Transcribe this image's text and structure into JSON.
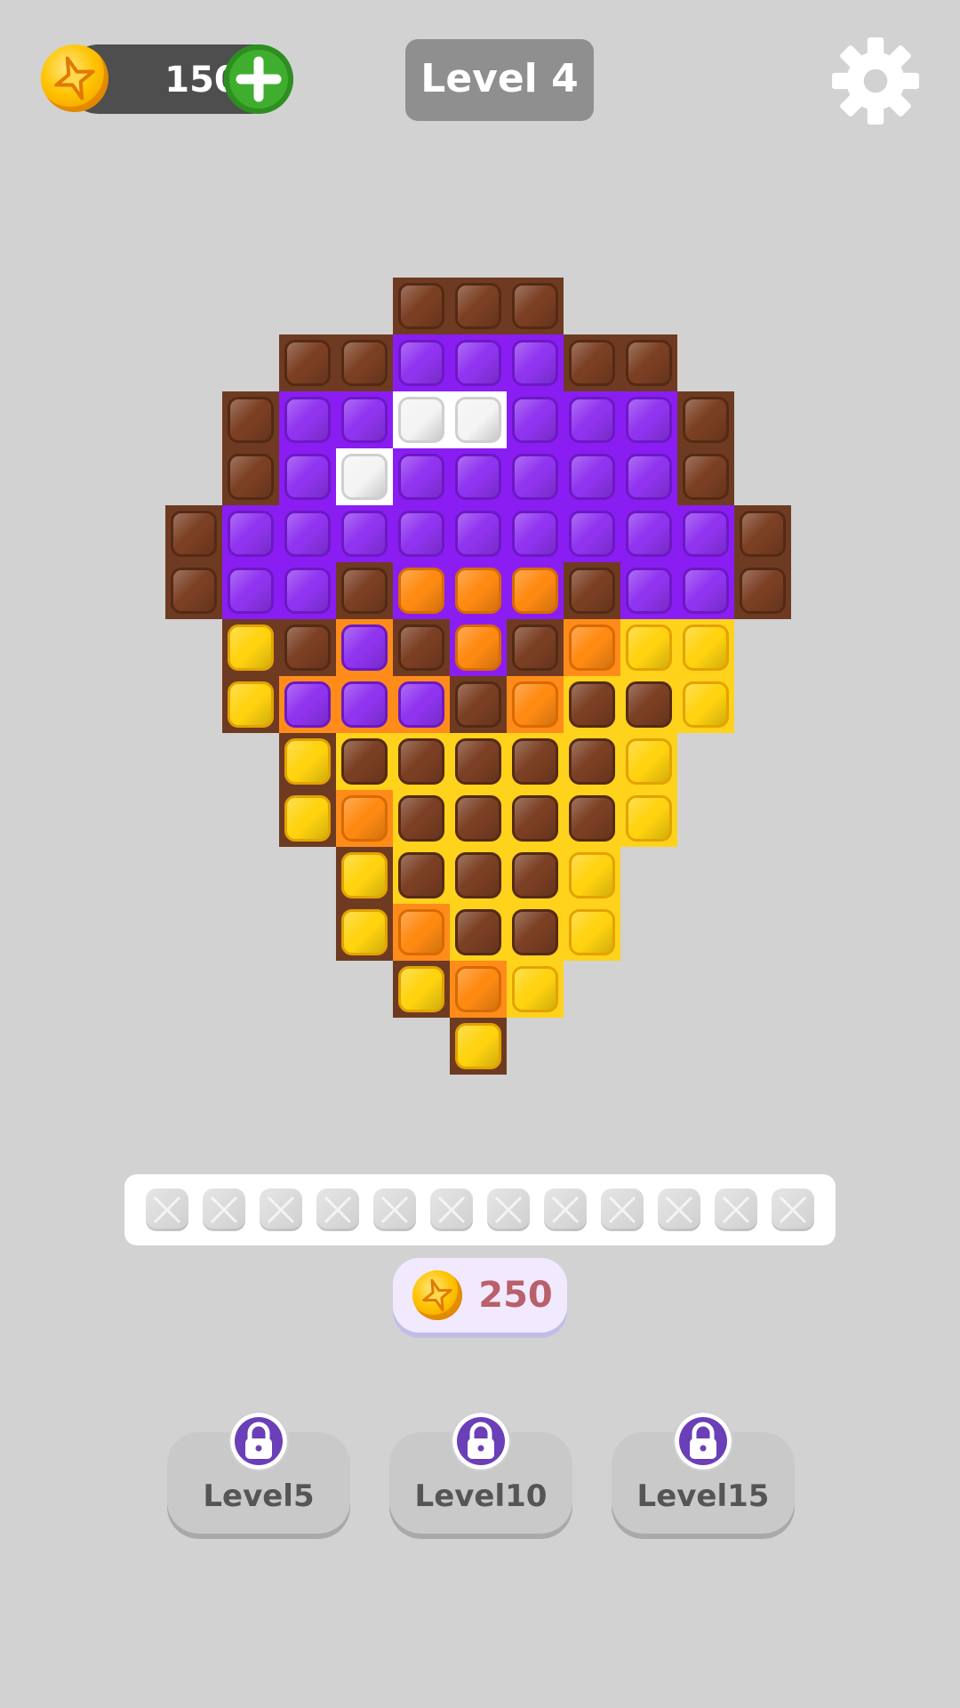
{
  "hud": {
    "coins": "150",
    "level": "Level 4"
  },
  "icons": {
    "coin": "coin-icon",
    "add": "plus-icon",
    "settings": "gear-icon",
    "lock": "lock-icon"
  },
  "palette": {
    "N": {
      "tile": "#6e3b22",
      "bead": "#7b3f23",
      "edge": "#552a14"
    },
    "P": {
      "tile": "#8a1ef2",
      "bead": "#9034f0",
      "edge": "#6d18c5"
    },
    "W": {
      "tile": "#ffffff",
      "bead": "#f4f4f4",
      "edge": "#cfcfcf"
    },
    "O": {
      "tile": "#ff8c1a",
      "bead": "#ff8a12",
      "edge": "#d86a00"
    },
    "Y": {
      "tile": "#ffd21c",
      "bead": "#ffd30f",
      "edge": "#e3a300"
    }
  },
  "board": {
    "rows": [
      "....NNN....",
      "..NNPPPNN..",
      ".NPPWWPPPN.",
      ".NPWPPPPPN.",
      "NPPPPPPPPPN",
      "NPPNOOONPPN",
      ".YNPNONOYY.",
      ".YPPPNONNY.",
      "..YNNNNNY..",
      "..YONNNNY..",
      "...YNNNY...",
      "...YONNY...",
      "....YOY....",
      ".....Y....."
    ],
    "cell_backgrounds": [
      "....NNN....",
      "..NNPPPNN..",
      ".NPPWWPPPN.",
      ".NPWPPPPPN.",
      "NPPPPPPPPPN",
      "NPPNPPPNPPN",
      ".NNONPNOYYN",
      ".NOOONOYYYN",
      "..NYYYYYYN.",
      "..NOYYYYYN.",
      "...NYYYYN..",
      "...NOYYYN..",
      "....NOYN...",
      ".....NN...."
    ]
  },
  "tray": {
    "slot_count": 12,
    "filled": 0
  },
  "price": {
    "amount": "250"
  },
  "locked_levels": [
    {
      "label": "Level5"
    },
    {
      "label": "Level10"
    },
    {
      "label": "Level15"
    }
  ]
}
